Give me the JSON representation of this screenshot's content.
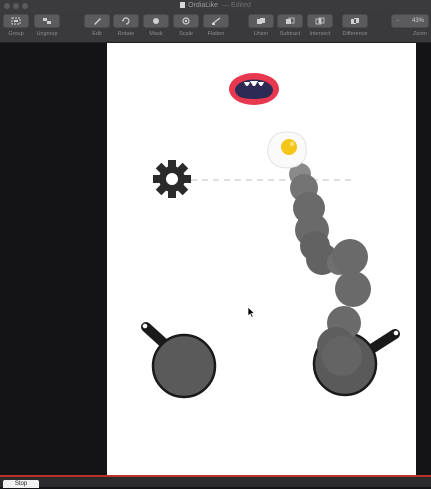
{
  "window": {
    "title": "OrdiaLike",
    "status": "— Edited"
  },
  "toolbar": {
    "left": [
      {
        "label": "Group",
        "icon": "group-icon"
      },
      {
        "label": "Ungroup",
        "icon": "ungroup-icon"
      }
    ],
    "middle": [
      {
        "label": "Edit",
        "icon": "edit-icon"
      },
      {
        "label": "Rotate",
        "icon": "rotate-icon"
      },
      {
        "label": "Mask",
        "icon": "mask-icon"
      },
      {
        "label": "Scale",
        "icon": "scale-icon"
      },
      {
        "label": "Flatten",
        "icon": "flatten-icon"
      }
    ],
    "boolean": [
      {
        "label": "Union",
        "icon": "union-icon"
      },
      {
        "label": "Subtract",
        "icon": "subtract-icon"
      },
      {
        "label": "Intersect",
        "icon": "intersect-icon"
      },
      {
        "label": "Difference",
        "icon": "difference-icon"
      }
    ],
    "zoom": {
      "value": "43%",
      "minus": "−",
      "label": "Zoom"
    }
  },
  "canvas": {
    "artboard_color": "#ffffff",
    "canvas_color": "#141416",
    "elements": [
      {
        "name": "mouth",
        "icon": "open-mouth-icon",
        "colors": {
          "lip": "#e8384f",
          "inside": "#2b2b55",
          "teeth": "#ffffff"
        }
      },
      {
        "name": "egg",
        "icon": "fried-egg-icon",
        "colors": {
          "white": "#fafafa",
          "yolk": "#f5c518"
        }
      },
      {
        "name": "gear",
        "icon": "gear-icon",
        "color": "#2a2a2a"
      },
      {
        "name": "dashed-guide",
        "icon": "dashed-line-icon",
        "color": "#cccccc"
      },
      {
        "name": "smoke-trail",
        "icon": "smoke-trail-icon",
        "color": "#6a6a6a"
      },
      {
        "name": "left-pan",
        "icon": "frying-pan-icon",
        "color": "#5a5a5a"
      },
      {
        "name": "right-pan",
        "icon": "frying-pan-icon",
        "color": "#5a5a5a"
      },
      {
        "name": "cursor",
        "icon": "mouse-pointer-icon",
        "color": "#000000"
      }
    ]
  },
  "bottombar": {
    "stop_label": "Stop"
  },
  "colors": {
    "accent_red": "#c0302a",
    "toolbar": "#3a3a3c"
  }
}
